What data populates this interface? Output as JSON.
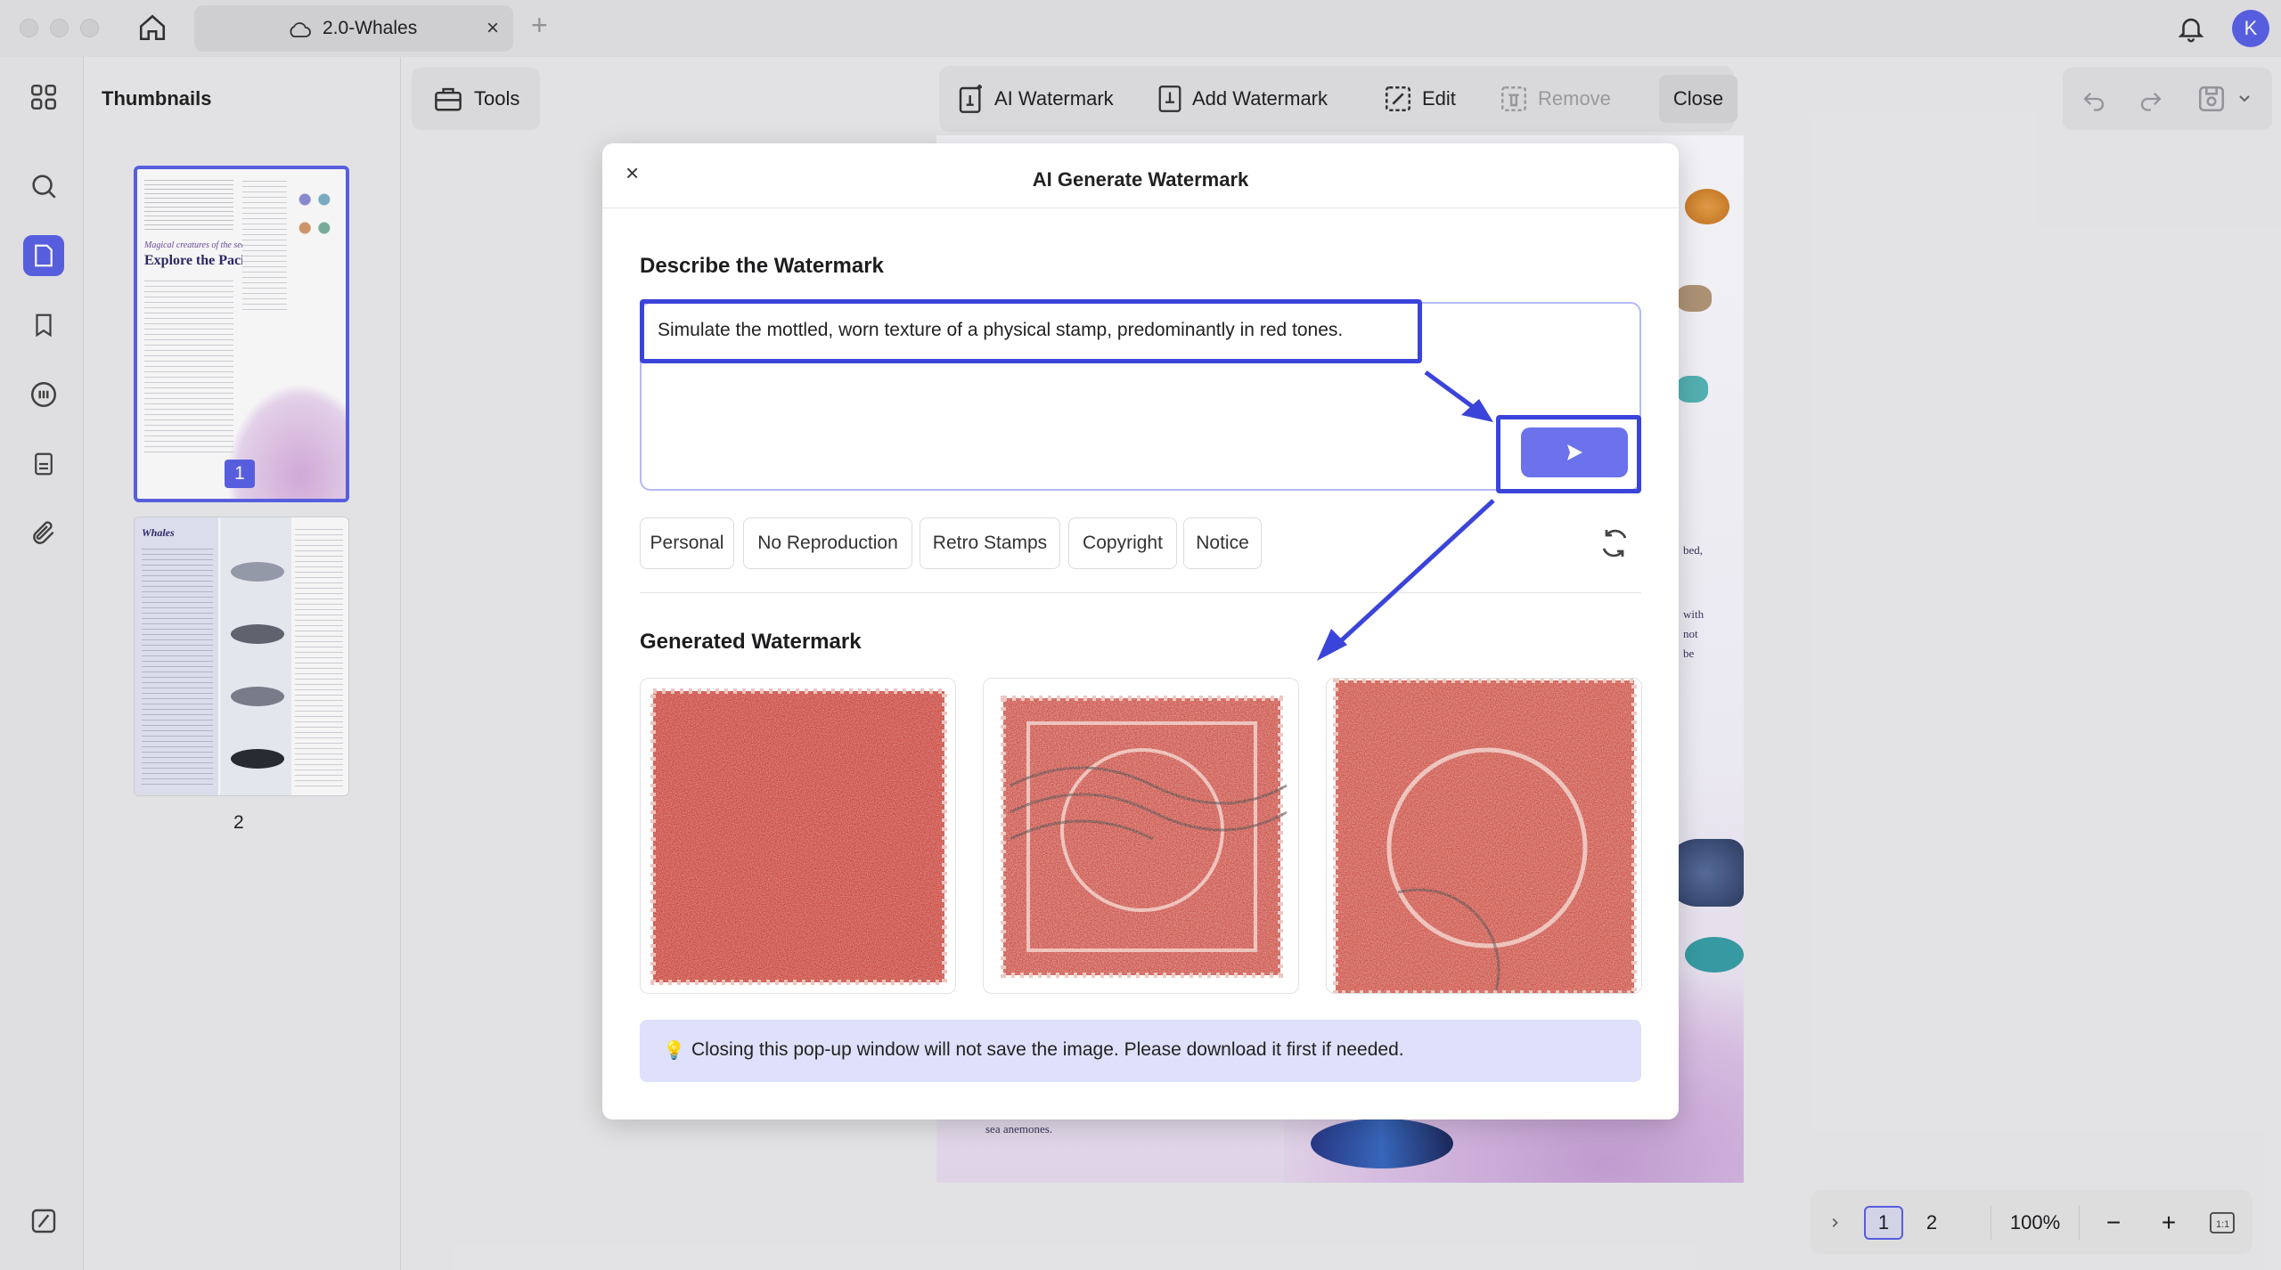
{
  "titlebar": {
    "tab_title": "2.0-Whales",
    "avatar_initial": "K"
  },
  "thumbnails": {
    "title": "Thumbnails",
    "pages": [
      {
        "number": "1",
        "heading": "Explore the Pacific",
        "subheading": "Magical creatures of the sea."
      },
      {
        "number": "2",
        "heading": "Whales"
      }
    ]
  },
  "toolbar": {
    "tools_label": "Tools",
    "ai_watermark": "AI Watermark",
    "add_watermark": "Add Watermark",
    "edit": "Edit",
    "remove": "Remove",
    "close": "Close"
  },
  "document": {
    "snippet_1": "sea anemones.",
    "snippet_2": "bed,",
    "snippet_3": "with",
    "snippet_4": "not",
    "snippet_5": "be"
  },
  "modal": {
    "title": "AI Generate Watermark",
    "describe_label": "Describe the Watermark",
    "prompt_text": "Simulate the mottled, worn texture of a physical stamp, predominantly in red tones.",
    "chips": [
      "Personal",
      "No Reproduction",
      "Retro Stamps",
      "Copyright",
      "Notice"
    ],
    "generated_label": "Generated Watermark",
    "notice": "Closing this pop-up window will not save the image. Please download it first if needed."
  },
  "pager": {
    "pages": [
      "1",
      "2"
    ],
    "current_page": "1",
    "zoom": "100%"
  },
  "colors": {
    "accent": "#5b62e8",
    "highlight_border": "#3b44d9",
    "stamp_red": "#c9433a",
    "notice_bg": "#dfe0fb"
  }
}
